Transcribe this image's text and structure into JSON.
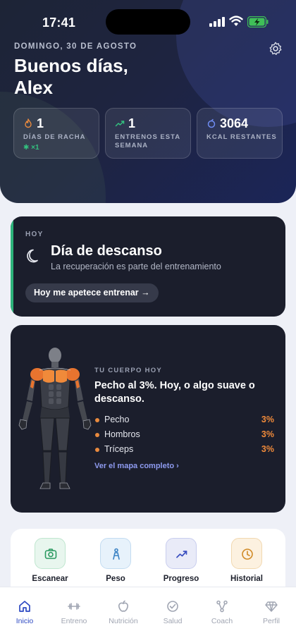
{
  "status": {
    "time": "17:41"
  },
  "header": {
    "date": "DOMINGO, 30 DE AGOSTO",
    "greeting": "Buenos días,\nAlex"
  },
  "stats": [
    {
      "value": "1",
      "label": "DÍAS DE RACHA",
      "extra": "✱ ×1",
      "icon": "flame-icon"
    },
    {
      "value": "1",
      "label": "ENTRENOS ESTA SEMANA",
      "icon": "trend-up-icon"
    },
    {
      "value": "3064",
      "label": "KCAL RESTANTES",
      "icon": "fire-icon"
    }
  ],
  "rest": {
    "kicker": "HOY",
    "title": "Día de descanso",
    "subtitle": "La recuperación es parte del entrenamiento",
    "button": "Hoy me apetece entrenar →"
  },
  "body_status": {
    "kicker": "TU CUERPO HOY",
    "message": "Pecho al 3%. Hoy, o algo suave o descanso.",
    "muscles": [
      {
        "name": "Pecho",
        "percent": "3%"
      },
      {
        "name": "Hombros",
        "percent": "3%"
      },
      {
        "name": "Tríceps",
        "percent": "3%"
      }
    ],
    "link": "Ver el mapa completo ›"
  },
  "quick_actions": [
    {
      "label": "Escanear",
      "icon": "camera-icon"
    },
    {
      "label": "Peso",
      "icon": "body-icon"
    },
    {
      "label": "Progreso",
      "icon": "trend-up-icon"
    },
    {
      "label": "Historial",
      "icon": "clock-icon"
    }
  ],
  "tabs": [
    {
      "label": "Inicio",
      "icon": "home-icon",
      "active": true
    },
    {
      "label": "Entreno",
      "icon": "dumbbell-icon"
    },
    {
      "label": "Nutrición",
      "icon": "apple-icon"
    },
    {
      "label": "Salud",
      "icon": "check-circle-icon"
    },
    {
      "label": "Coach",
      "icon": "nodes-icon"
    },
    {
      "label": "Perfil",
      "icon": "diamond-icon"
    }
  ],
  "colors": {
    "accent": "#2d49c2",
    "rest_accent": "#2db37a",
    "muscle_highlight": "#f08a3a"
  }
}
